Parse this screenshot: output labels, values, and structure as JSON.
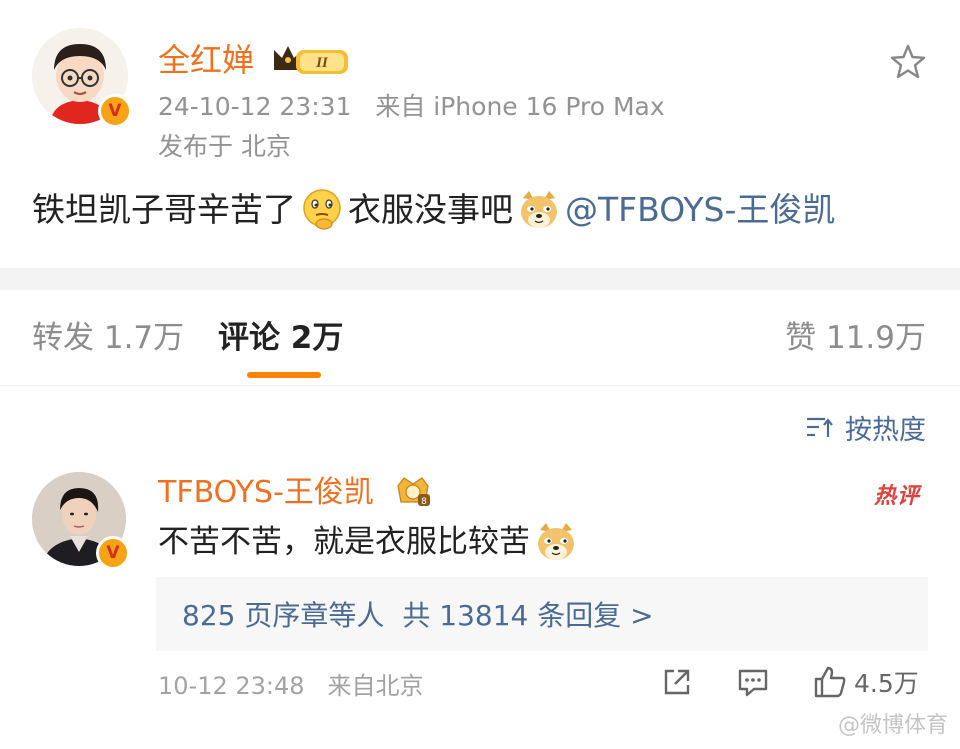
{
  "post": {
    "author": "全红婵",
    "vip_level": "II",
    "timestamp": "24-10-12 23:31",
    "source": "来自 iPhone 16 Pro Max",
    "location": "发布于 北京",
    "text_part1": "铁坦凯子哥辛苦了",
    "text_part2": "衣服没事吧",
    "mention": "@TFBOYS-王俊凯",
    "verified_mark": "V"
  },
  "tabs": {
    "repost": "转发 1.7万",
    "comment": "评论 2万",
    "like": "赞 11.9万"
  },
  "sort": {
    "label": "按热度"
  },
  "comment": {
    "author": "TFBOYS-王俊凯",
    "hot_tag": "热评",
    "text": "不苦不苦，就是衣服比较苦",
    "reply_summary_people": "825 页序章等人",
    "reply_summary_count": "共 13814 条回复 >",
    "time": "10-12 23:48",
    "location": "来自北京",
    "likes": "4.5万",
    "verified_mark": "V"
  },
  "watermark": "@微博体育",
  "colors": {
    "username": "#f0701f",
    "link": "#4b6b95",
    "tab_indicator": "#ff8200",
    "hot_tag": "#e0413a"
  }
}
